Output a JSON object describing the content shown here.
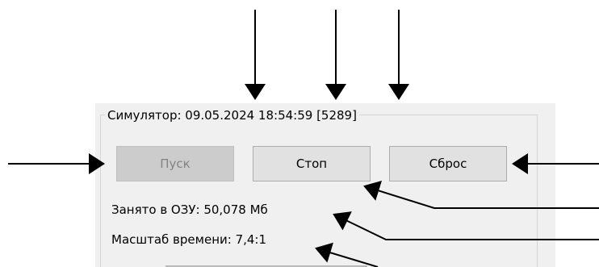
{
  "simulator": {
    "title": "Симулятор: 09.05.2024 18:54:59 [5289]"
  },
  "buttons": {
    "start_label": "Пуск",
    "stop_label": "Стоп",
    "reset_label": "Сброс"
  },
  "info": {
    "ram_usage": "Занято в ОЗУ: 50,078 Мб",
    "time_scale": "Масштаб времени: 7,4:1"
  },
  "colors": {
    "panel_bg": "#f0f0f0",
    "button_bg": "#e1e1e1",
    "disabled_text": "#838383",
    "arrow": "#000000"
  }
}
